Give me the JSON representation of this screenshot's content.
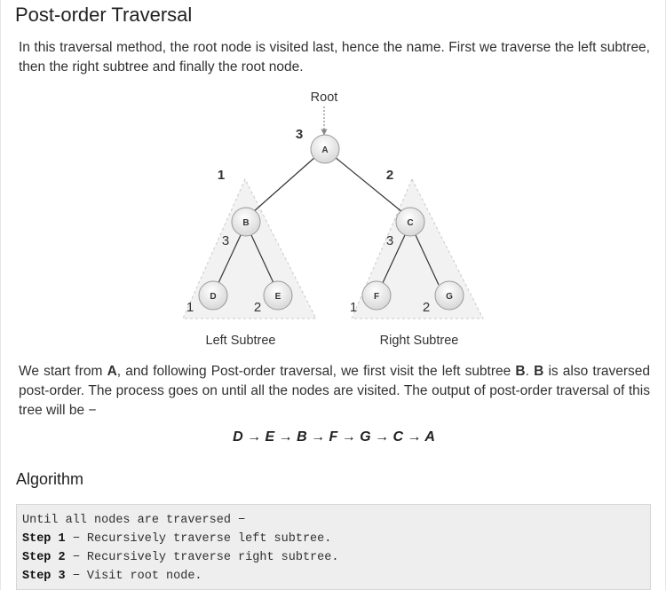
{
  "page": {
    "title": "Post-order Traversal",
    "intro": "In this traversal method, the root node is visited last, hence the name. First we traverse the left subtree, then the right subtree and finally the root node."
  },
  "figure": {
    "root_label": "Root",
    "left_caption": "Left Subtree",
    "right_caption": "Right Subtree",
    "nodes": {
      "A": "A",
      "B": "B",
      "C": "C",
      "D": "D",
      "E": "E",
      "F": "F",
      "G": "G"
    },
    "order_labels": {
      "root": "3",
      "left_subtree": "1",
      "right_subtree": "2",
      "B_order": "3",
      "D_order": "1",
      "E_order": "2",
      "C_order": "3",
      "F_order": "1",
      "G_order": "2"
    }
  },
  "body": {
    "p1": "We start from",
    "a": "A",
    "p2": ", and following Post-order traversal, we first visit the left subtree",
    "b1": "B",
    "p3": ".",
    "b2": "B",
    "p4": "is also traversed post-order. The process goes on until all the nodes are visited. The output of post-order traversal of this tree will be −",
    "output": "D → E → B → F → G → C → A"
  },
  "algorithm": {
    "title": "Algorithm",
    "intro_line": "Until all nodes are traversed −",
    "steps": [
      {
        "label": "Step 1",
        "text": " − Recursively traverse left subtree."
      },
      {
        "label": "Step 2",
        "text": " − Recursively traverse right subtree."
      },
      {
        "label": "Step 3",
        "text": " − Visit root node."
      }
    ]
  }
}
